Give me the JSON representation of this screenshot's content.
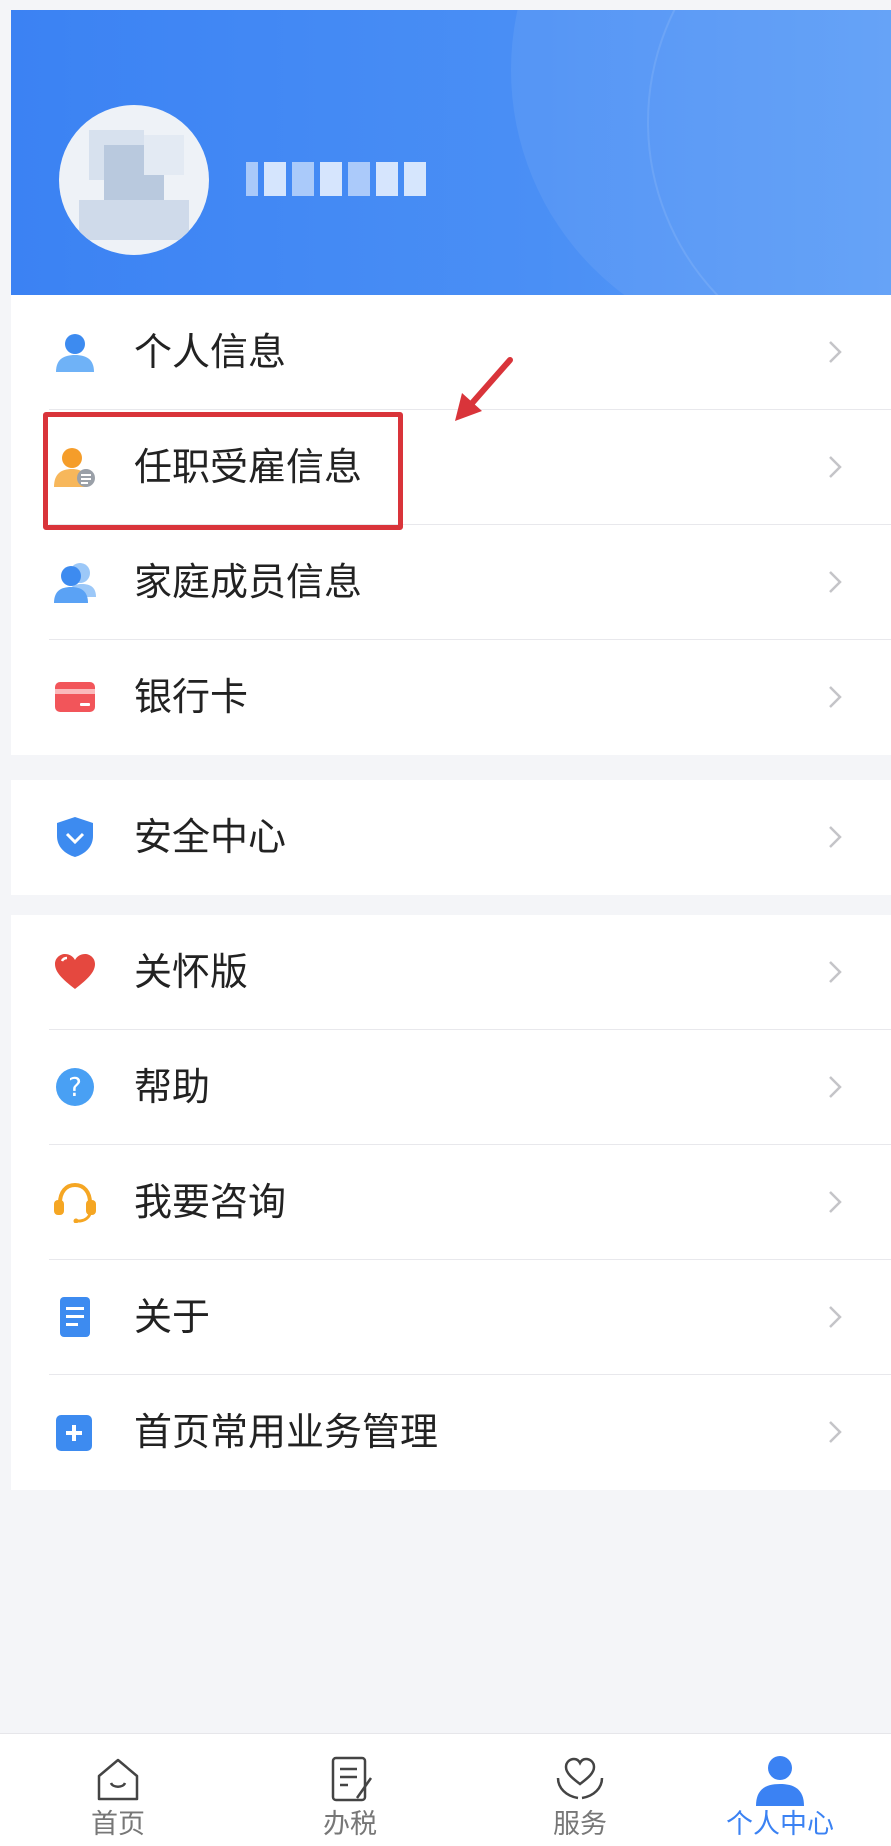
{
  "header": {
    "username": ""
  },
  "menu_groups": [
    {
      "items": [
        {
          "label": "个人信息",
          "icon": "person-icon"
        },
        {
          "label": "任职受雇信息",
          "icon": "employment-icon"
        },
        {
          "label": "家庭成员信息",
          "icon": "family-members-icon"
        },
        {
          "label": "银行卡",
          "icon": "bank-card-icon"
        }
      ]
    },
    {
      "items": [
        {
          "label": "安全中心",
          "icon": "shield-icon"
        }
      ]
    },
    {
      "items": [
        {
          "label": "关怀版",
          "icon": "heart-icon"
        },
        {
          "label": "帮助",
          "icon": "help-icon"
        },
        {
          "label": "我要咨询",
          "icon": "headset-icon"
        },
        {
          "label": "关于",
          "icon": "document-icon"
        },
        {
          "label": "首页常用业务管理",
          "icon": "add-square-icon"
        }
      ]
    }
  ],
  "tabbar": {
    "items": [
      {
        "label": "首页",
        "icon": "home-icon"
      },
      {
        "label": "办税",
        "icon": "tax-document-icon"
      },
      {
        "label": "服务",
        "icon": "service-heart-icon"
      },
      {
        "label": "个人中心",
        "icon": "person-center-icon"
      }
    ],
    "active": "个人中心"
  },
  "colors": {
    "accent": "#3b82f3",
    "highlight": "#d9343a",
    "background": "#f4f5f8"
  }
}
